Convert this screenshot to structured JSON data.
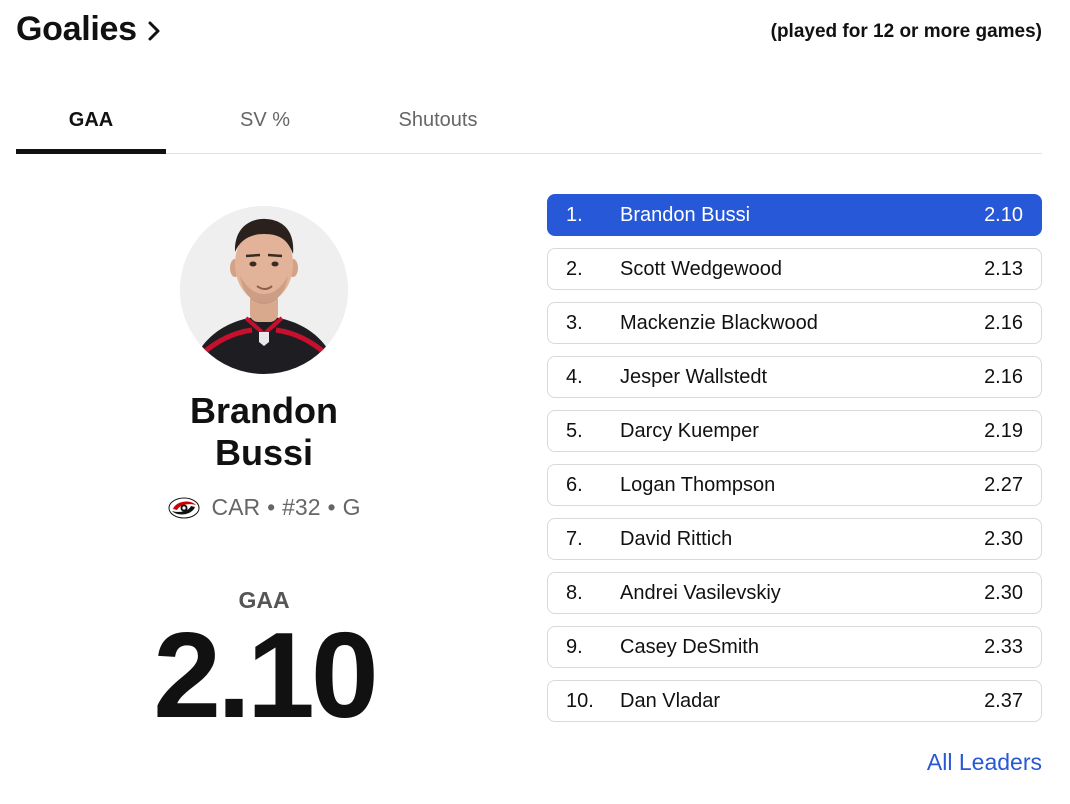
{
  "header": {
    "title": "Goalies",
    "qualifier": "(played for 12 or more games)"
  },
  "tabs": [
    {
      "label": "GAA",
      "active": true
    },
    {
      "label": "SV %",
      "active": false
    },
    {
      "label": "Shutouts",
      "active": false
    }
  ],
  "featured": {
    "name_line1": "Brandon",
    "name_line2": "Bussi",
    "team": "CAR",
    "bullet": "•",
    "number": "#32",
    "position": "G",
    "stat_label": "GAA",
    "stat_value": "2.10"
  },
  "leaders": [
    {
      "rank": "1.",
      "name": "Brandon Bussi",
      "value": "2.10"
    },
    {
      "rank": "2.",
      "name": "Scott Wedgewood",
      "value": "2.13"
    },
    {
      "rank": "3.",
      "name": "Mackenzie Blackwood",
      "value": "2.16"
    },
    {
      "rank": "4.",
      "name": "Jesper Wallstedt",
      "value": "2.16"
    },
    {
      "rank": "5.",
      "name": "Darcy Kuemper",
      "value": "2.19"
    },
    {
      "rank": "6.",
      "name": "Logan Thompson",
      "value": "2.27"
    },
    {
      "rank": "7.",
      "name": "David Rittich",
      "value": "2.30"
    },
    {
      "rank": "8.",
      "name": "Andrei Vasilevskiy",
      "value": "2.30"
    },
    {
      "rank": "9.",
      "name": "Casey DeSmith",
      "value": "2.33"
    },
    {
      "rank": "10.",
      "name": "Dan Vladar",
      "value": "2.37"
    }
  ],
  "footer": {
    "all_leaders_label": "All Leaders"
  },
  "icons": {
    "chevron": "chevron-right-icon",
    "team_logo": "hurricanes-logo"
  },
  "colors": {
    "accent": "#2758d8",
    "text": "#111111",
    "muted": "#666666",
    "team_red": "#cc0000"
  }
}
